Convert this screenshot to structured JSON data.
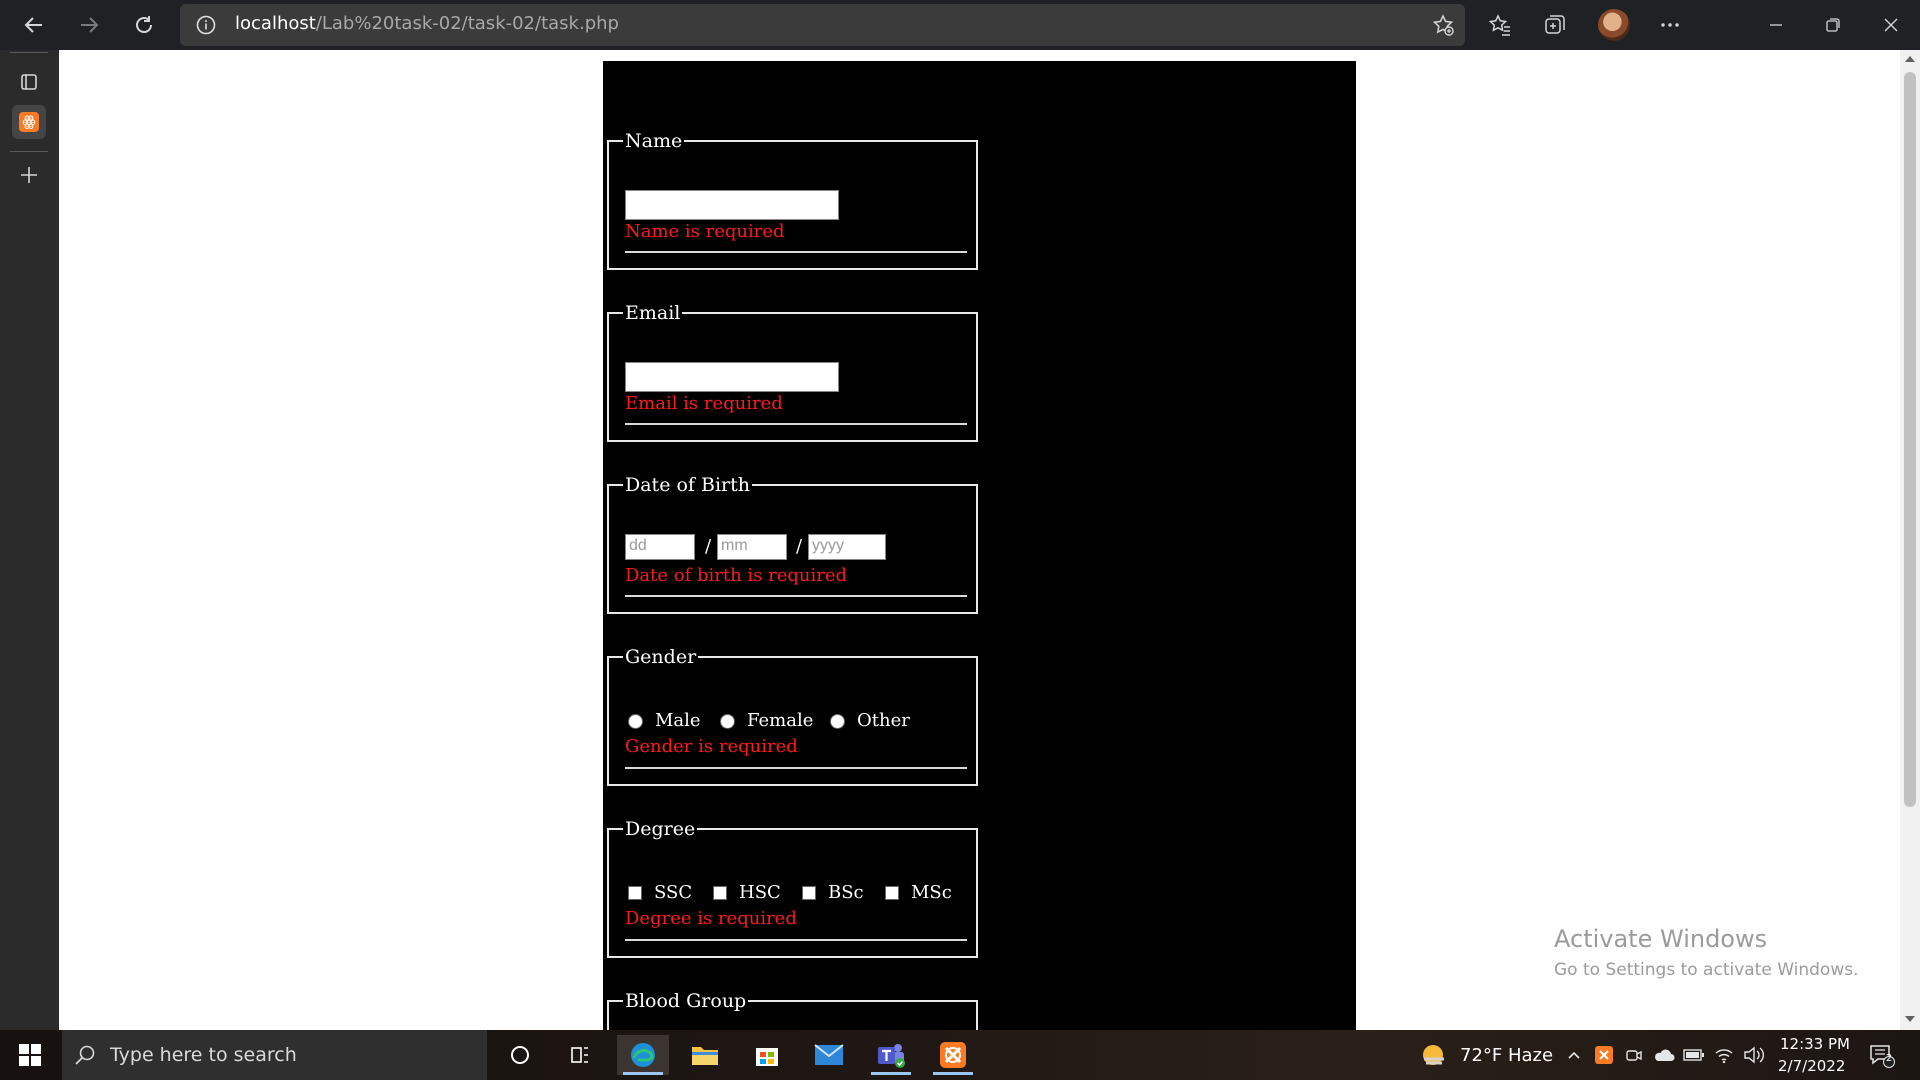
{
  "browser": {
    "url_host": "localhost",
    "url_path": "/Lab%20task-02/task-02/task.php"
  },
  "form": {
    "name": {
      "legend": "Name",
      "error": "Name is required"
    },
    "email": {
      "legend": "Email",
      "error": "Email is required"
    },
    "dob": {
      "legend": "Date of Birth",
      "day_placeholder": "dd",
      "month_placeholder": "mm",
      "year_placeholder": "yyyy",
      "separator": "/",
      "error": "Date of birth is required"
    },
    "gender": {
      "legend": "Gender",
      "options": [
        "Male",
        "Female",
        "Other"
      ],
      "error": "Gender is required"
    },
    "degree": {
      "legend": "Degree",
      "options": [
        "SSC",
        "HSC",
        "BSc",
        "MSc"
      ],
      "error": "Degree is required"
    },
    "blood_group": {
      "legend": "Blood Group"
    }
  },
  "watermark": {
    "title": "Activate Windows",
    "subtitle": "Go to Settings to activate Windows."
  },
  "taskbar": {
    "search_placeholder": "Type here to search",
    "weather": "72°F  Haze",
    "time": "12:33 PM",
    "date": "2/7/2022",
    "notification_count": "2"
  },
  "colors": {
    "error": "#ff1a1a",
    "panel_bg": "#000000",
    "browser_chrome": "#202124"
  }
}
